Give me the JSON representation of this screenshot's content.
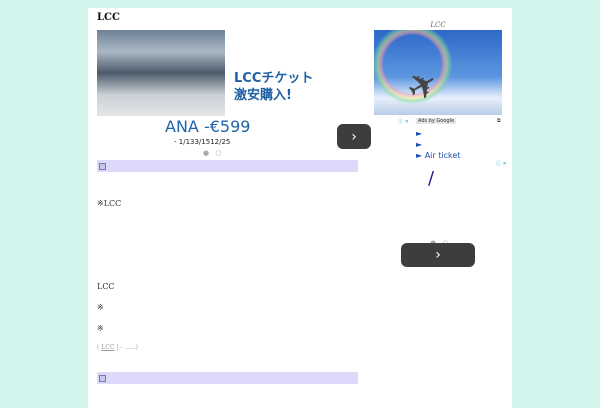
{
  "site_title": "LCC",
  "main_ad": {
    "headline_line1": "LCCチケット",
    "headline_line2": "激安購入!",
    "price": "ANA -€599",
    "dates": "- 1/133/1512/25",
    "dots": "● ○",
    "next": "›"
  },
  "content": {
    "note1": "※LCC",
    "heading": "LCC",
    "mark1": "※",
    "mark2": "※",
    "breadcrumb_prefix": "(",
    "breadcrumb_link": "LCC",
    "breadcrumb_rest": "| - ......)"
  },
  "sidebar": {
    "title": "LCC",
    "ads_by": "Ads by Google",
    "ad_choice": "ⓘ ✕",
    "links": [
      "►",
      "►",
      "► Air ticket"
    ],
    "slash": "/",
    "dots": "● ○",
    "next": "›"
  }
}
